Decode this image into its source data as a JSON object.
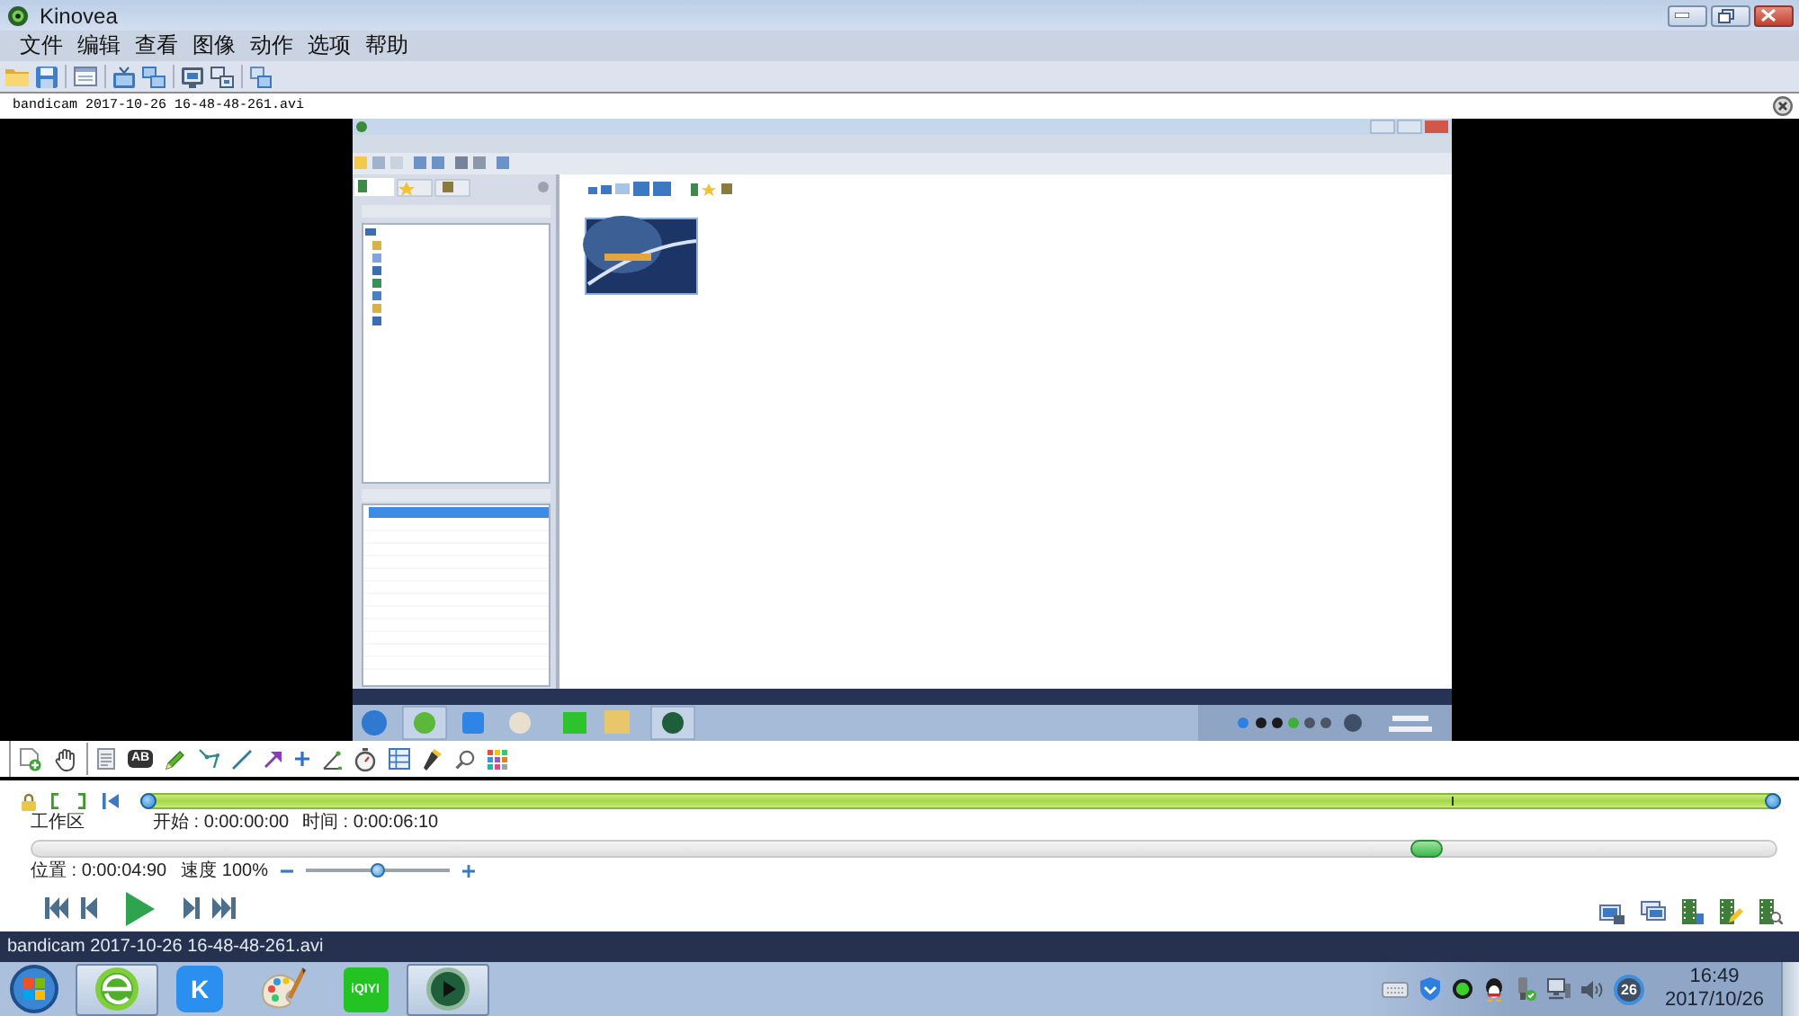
{
  "window": {
    "title": "Kinovea"
  },
  "menu": [
    {
      "label": "文件"
    },
    {
      "label": "编辑"
    },
    {
      "label": "查看"
    },
    {
      "label": "图像"
    },
    {
      "label": "动作"
    },
    {
      "label": "选项"
    },
    {
      "label": "帮助"
    }
  ],
  "toolbar": [
    {
      "buttons": [
        {
          "kind": "folder"
        },
        {
          "kind": "save"
        }
      ]
    },
    {
      "buttons": [
        {
          "kind": "browser"
        }
      ]
    },
    {
      "buttons": [
        {
          "kind": "single-screen"
        },
        {
          "kind": "dual-screen"
        }
      ]
    },
    {
      "buttons": [
        {
          "kind": "capture"
        },
        {
          "kind": "dual-capture"
        }
      ]
    },
    {
      "buttons": [
        {
          "kind": "swap"
        }
      ]
    }
  ],
  "file_tab": {
    "title": "bandicam 2017-10-26 16-48-48-261.avi"
  },
  "drawing_tools": [
    {
      "buttons": [
        {
          "kind": "add-image"
        },
        {
          "kind": "hand"
        }
      ]
    },
    {
      "buttons": [
        {
          "kind": "note"
        },
        {
          "kind": "label",
          "text": "AB"
        },
        {
          "kind": "pencil"
        },
        {
          "kind": "polyline"
        },
        {
          "kind": "line"
        },
        {
          "kind": "arrow"
        },
        {
          "kind": "cross"
        },
        {
          "kind": "angle"
        },
        {
          "kind": "stopwatch"
        },
        {
          "kind": "grid"
        },
        {
          "kind": "flashlight"
        },
        {
          "kind": "magnifier"
        },
        {
          "kind": "colors"
        }
      ]
    }
  ],
  "working_zone": {
    "buttons": [
      {
        "kind": "lock"
      },
      {
        "kind": "start-bracket"
      },
      {
        "kind": "end-bracket"
      },
      {
        "kind": "jump-start"
      }
    ],
    "label": "工作区",
    "start": "开始 : 0:00:00:00",
    "duration": "时间 : 0:00:06:10"
  },
  "position": {
    "label": "位置 : 0:00:04:90",
    "level": 0.8
  },
  "speed": {
    "label": "速度 100%",
    "level": 0.5
  },
  "playback": [
    {
      "kind": "first"
    },
    {
      "kind": "previous"
    },
    {
      "kind": "play"
    },
    {
      "kind": "next"
    },
    {
      "kind": "last"
    }
  ],
  "export": [
    {
      "kind": "save-image"
    },
    {
      "kind": "save-images"
    },
    {
      "kind": "save-video"
    },
    {
      "kind": "edit-video"
    },
    {
      "kind": "video-info"
    }
  ],
  "status_bar": {
    "text": "bandicam 2017-10-26 16-48-48-261.avi"
  },
  "taskbar": {
    "apps": [
      {
        "kind": "browser",
        "running": true
      },
      {
        "kind": "letter",
        "text": "K",
        "running": false
      },
      {
        "kind": "paint",
        "running": false
      },
      {
        "kind": "wordmark",
        "text": "iQIYI",
        "running": false
      },
      {
        "kind": "player",
        "running": true
      }
    ],
    "tray": [
      {
        "kind": "keyboard"
      },
      {
        "kind": "shield"
      },
      {
        "kind": "dot"
      },
      {
        "kind": "penguin"
      },
      {
        "kind": "usb"
      },
      {
        "kind": "network"
      },
      {
        "kind": "volume"
      },
      {
        "kind": "badge",
        "text": "26"
      }
    ],
    "clock": {
      "time": "16:49",
      "date": "2017/10/26"
    }
  }
}
